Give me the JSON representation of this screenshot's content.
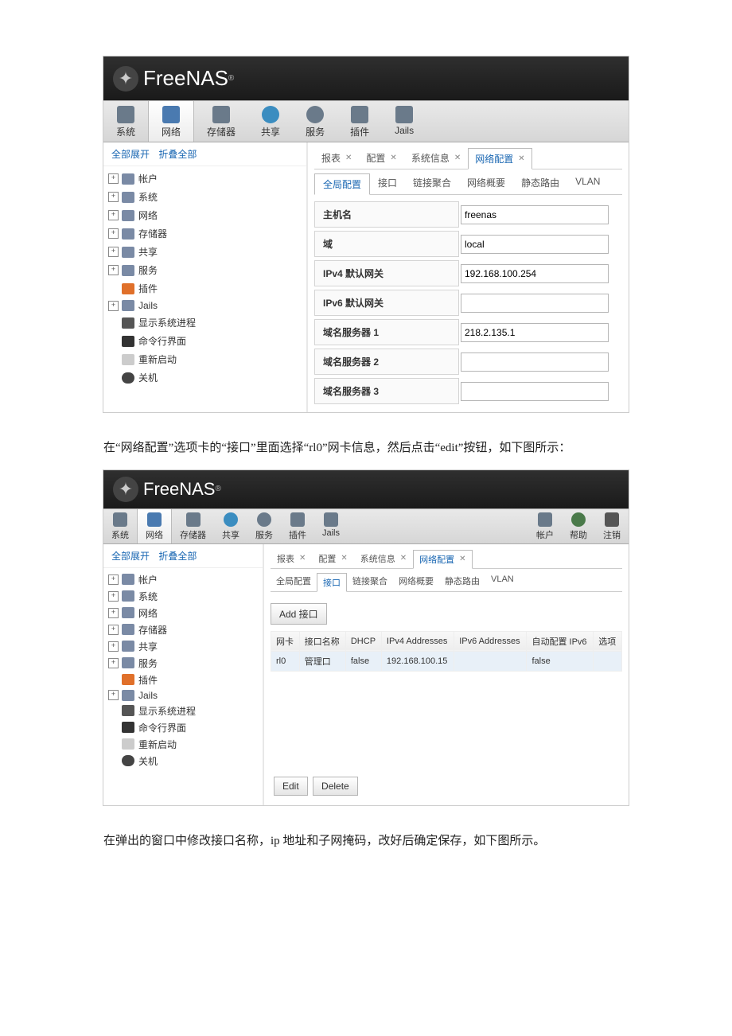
{
  "brand": "FreeNAS",
  "doc_text_1": "在“网络配置”选项卡的“接口”里面选择“rl0”网卡信息，然后点击“edit”按钮，如下图所示：",
  "doc_text_2": "在弹出的窗口中修改接口名称，ip 地址和子网掩码，改好后确定保存，如下图所示。",
  "shot1": {
    "toolbar": [
      "系统",
      "网络",
      "存储器",
      "共享",
      "服务",
      "插件",
      "Jails"
    ],
    "treectrl": {
      "expand": "全部展开",
      "collapse": "折叠全部"
    },
    "tree": [
      {
        "label": "帐户",
        "exp": true
      },
      {
        "label": "系统",
        "exp": true
      },
      {
        "label": "网络",
        "exp": true
      },
      {
        "label": "存储器",
        "exp": true
      },
      {
        "label": "共享",
        "exp": true
      },
      {
        "label": "服务",
        "exp": true
      },
      {
        "label": "插件",
        "exp": false,
        "leaf": true
      },
      {
        "label": "Jails",
        "exp": true
      },
      {
        "label": "显示系统进程",
        "leaf": true
      },
      {
        "label": "命令行界面",
        "leaf": true
      },
      {
        "label": "重新启动",
        "leaf": true
      },
      {
        "label": "关机",
        "leaf": true
      }
    ],
    "tabs": [
      "报表",
      "配置",
      "系统信息",
      "网络配置"
    ],
    "active_tab": 3,
    "subtabs": [
      "全局配置",
      "接口",
      "链接聚合",
      "网络概要",
      "静态路由",
      "VLAN"
    ],
    "active_subtab": 0,
    "form": [
      {
        "label": "主机名",
        "value": "freenas"
      },
      {
        "label": "域",
        "value": "local"
      },
      {
        "label": "IPv4 默认网关",
        "value": "192.168.100.254"
      },
      {
        "label": "IPv6 默认网关",
        "value": ""
      },
      {
        "label": "域名服务器 1",
        "value": "218.2.135.1"
      },
      {
        "label": "域名服务器 2",
        "value": ""
      },
      {
        "label": "域名服务器 3",
        "value": ""
      }
    ]
  },
  "shot2": {
    "toolbar_left": [
      "系统",
      "网络",
      "存储器",
      "共享",
      "服务",
      "插件",
      "Jails"
    ],
    "toolbar_right": [
      "帐户",
      "帮助",
      "注销"
    ],
    "treectrl": {
      "expand": "全部展开",
      "collapse": "折叠全部"
    },
    "tree": [
      {
        "label": "帐户",
        "exp": true
      },
      {
        "label": "系统",
        "exp": true
      },
      {
        "label": "网络",
        "exp": true
      },
      {
        "label": "存储器",
        "exp": true
      },
      {
        "label": "共享",
        "exp": true
      },
      {
        "label": "服务",
        "exp": true
      },
      {
        "label": "插件",
        "leaf": true
      },
      {
        "label": "Jails",
        "exp": true
      },
      {
        "label": "显示系统进程",
        "leaf": true
      },
      {
        "label": "命令行界面",
        "leaf": true
      },
      {
        "label": "重新启动",
        "leaf": true
      },
      {
        "label": "关机",
        "leaf": true
      }
    ],
    "tabs": [
      "报表",
      "配置",
      "系统信息",
      "网络配置"
    ],
    "active_tab": 3,
    "subtabs": [
      "全局配置",
      "接口",
      "链接聚合",
      "网络概要",
      "静态路由",
      "VLAN"
    ],
    "active_subtab": 1,
    "add_btn": "Add 接口",
    "grid": {
      "headers": [
        "网卡",
        "接口名称",
        "DHCP",
        "IPv4 Addresses",
        "IPv6 Addresses",
        "自动配置 IPv6",
        "选项"
      ],
      "row": [
        "rl0",
        "管理口",
        "false",
        "192.168.100.15",
        "",
        "false",
        ""
      ]
    },
    "buttons": [
      "Edit",
      "Delete"
    ]
  }
}
